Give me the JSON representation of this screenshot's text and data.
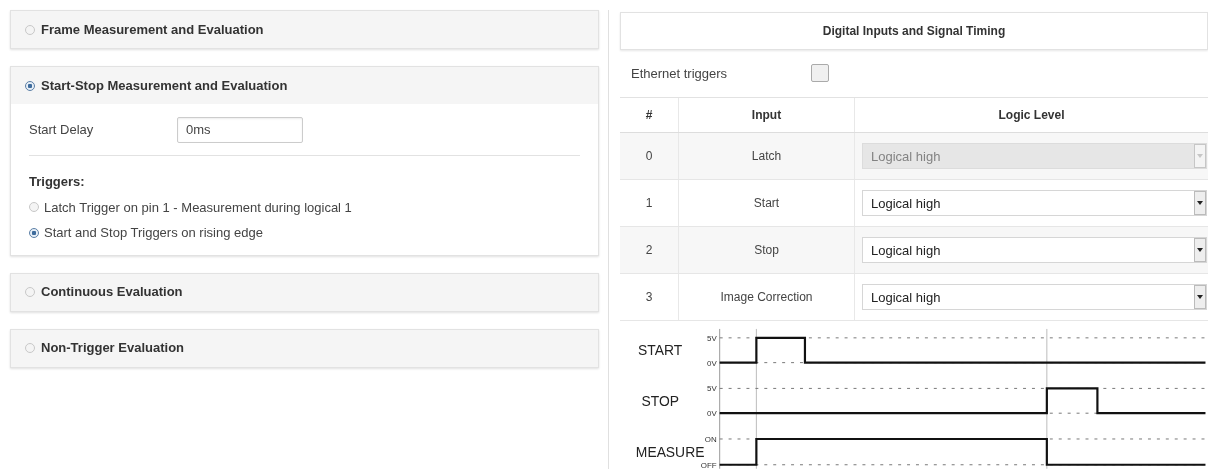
{
  "sections": [
    {
      "title": "Frame Measurement and Evaluation",
      "selected": false
    },
    {
      "title": "Start-Stop Measurement and Evaluation",
      "selected": true,
      "start_delay": {
        "label": "Start Delay",
        "value": "0ms"
      },
      "triggers": {
        "label": "Triggers:",
        "options": [
          {
            "label": "Latch Trigger on pin 1 - Measurement during logical 1",
            "selected": false
          },
          {
            "label": "Start and Stop Triggers on rising edge",
            "selected": true
          }
        ]
      }
    },
    {
      "title": "Continuous Evaluation",
      "selected": false
    },
    {
      "title": "Non-Trigger Evaluation",
      "selected": false
    }
  ],
  "inputs_panel": {
    "title": "Digital Inputs and Signal Timing",
    "ethernet_triggers": {
      "label": "Ethernet triggers",
      "checked": false
    },
    "table": {
      "columns": [
        "#",
        "Input",
        "Logic Level"
      ],
      "rows": [
        {
          "index": "0",
          "input": "Latch",
          "logic_level": "Logical high",
          "disabled": true
        },
        {
          "index": "1",
          "input": "Start",
          "logic_level": "Logical high",
          "disabled": false
        },
        {
          "index": "2",
          "input": "Stop",
          "logic_level": "Logical high",
          "disabled": false
        },
        {
          "index": "3",
          "input": "Image Correction",
          "logic_level": "Logical high",
          "disabled": false
        }
      ]
    },
    "timing_diagram": {
      "signals": [
        {
          "name": "START",
          "high": "5V",
          "low": "0V"
        },
        {
          "name": "STOP",
          "high": "5V",
          "low": "0V"
        },
        {
          "name": "MEASURE",
          "high": "ON",
          "low": "OFF"
        }
      ]
    }
  }
}
